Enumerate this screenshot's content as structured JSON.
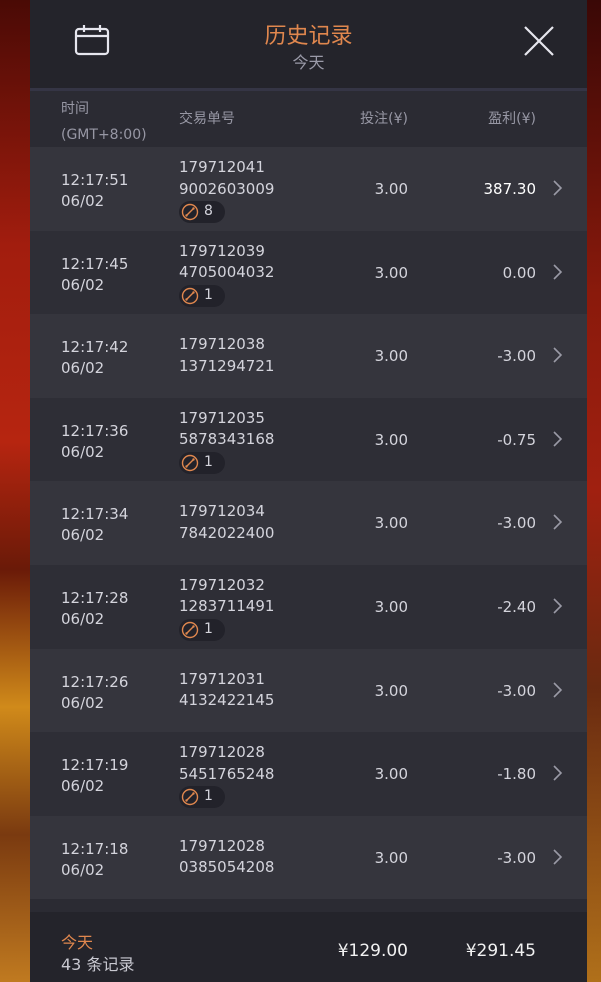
{
  "header": {
    "title": "历史记录",
    "subtitle": "今天"
  },
  "columns": {
    "time_line1": "时间",
    "time_line2": "(GMT+8:00)",
    "order": "交易单号",
    "bet": "投注(¥)",
    "profit": "盈利(¥)"
  },
  "rows": [
    {
      "time": "12:17:51",
      "date": "06/02",
      "order1": "179712041",
      "order2": "9002603009",
      "badge": "8",
      "bet": "3.00",
      "profit": "387.30"
    },
    {
      "time": "12:17:45",
      "date": "06/02",
      "order1": "179712039",
      "order2": "4705004032",
      "badge": "1",
      "bet": "3.00",
      "profit": "0.00"
    },
    {
      "time": "12:17:42",
      "date": "06/02",
      "order1": "179712038",
      "order2": "1371294721",
      "bet": "3.00",
      "profit": "-3.00"
    },
    {
      "time": "12:17:36",
      "date": "06/02",
      "order1": "179712035",
      "order2": "5878343168",
      "badge": "1",
      "bet": "3.00",
      "profit": "-0.75"
    },
    {
      "time": "12:17:34",
      "date": "06/02",
      "order1": "179712034",
      "order2": "7842022400",
      "bet": "3.00",
      "profit": "-3.00"
    },
    {
      "time": "12:17:28",
      "date": "06/02",
      "order1": "179712032",
      "order2": "1283711491",
      "badge": "1",
      "bet": "3.00",
      "profit": "-2.40"
    },
    {
      "time": "12:17:26",
      "date": "06/02",
      "order1": "179712031",
      "order2": "4132422145",
      "bet": "3.00",
      "profit": "-3.00"
    },
    {
      "time": "12:17:19",
      "date": "06/02",
      "order1": "179712028",
      "order2": "5451765248",
      "badge": "1",
      "bet": "3.00",
      "profit": "-1.80"
    },
    {
      "time": "12:17:18",
      "date": "06/02",
      "order1": "179712028",
      "order2": "0385054208",
      "bet": "3.00",
      "profit": "-3.00"
    }
  ],
  "footer": {
    "label": "今天",
    "count": "43 条记录",
    "total_bet": "¥129.00",
    "total_profit": "¥291.45"
  },
  "colors": {
    "accent": "#e0874e",
    "panel": "#2b2b33"
  }
}
